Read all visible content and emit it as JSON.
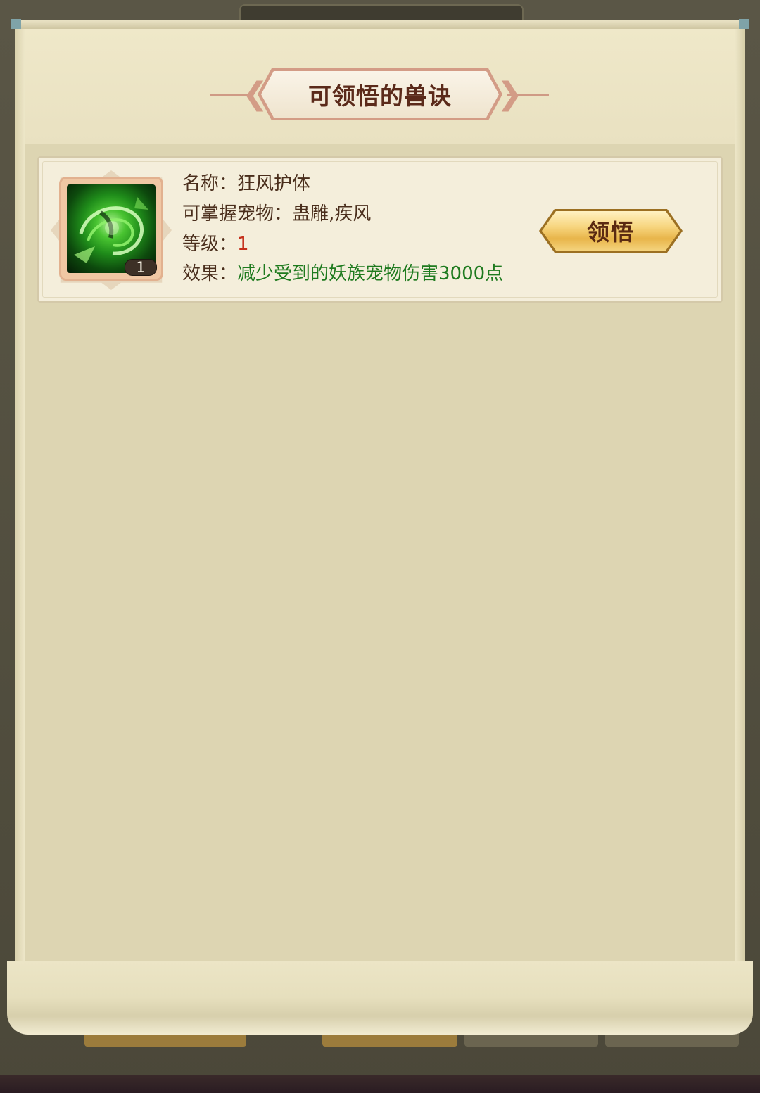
{
  "panel": {
    "title": "可领悟的兽诀"
  },
  "skill": {
    "icon": "green-wind-swirl-icon",
    "level_badge": "1",
    "name_label": "名称：",
    "name_value": "狂风护体",
    "pets_label": "可掌握宠物：",
    "pets_value": "蛊雕,疾风",
    "level_label": "等级：",
    "level_value": "1",
    "effect_label": "效果：",
    "effect_value": "减少受到的妖族宠物伤害3000点"
  },
  "actions": {
    "learn_label": "领悟"
  },
  "colors": {
    "title_text": "#5b2a1a",
    "label_text": "#4a2e1c",
    "level_red": "#c42e1a",
    "effect_green": "#1e7a1e",
    "button_gold": "#f7d57e"
  }
}
